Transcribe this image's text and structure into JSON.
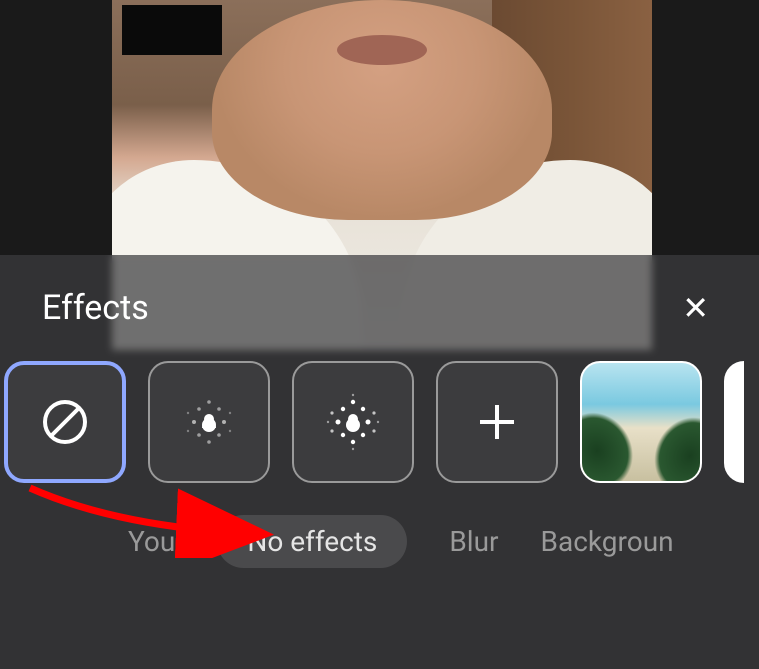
{
  "panel": {
    "title": "Effects",
    "close_label": "✕"
  },
  "tiles": {
    "none": {
      "name": "no-effect"
    },
    "blur_light": {
      "name": "blur-light"
    },
    "blur_strong": {
      "name": "blur-strong"
    },
    "add": {
      "name": "add-custom"
    },
    "bg1": {
      "name": "beach-background"
    }
  },
  "chips": {
    "you": "You",
    "no_effects": "No effects",
    "blur": "Blur",
    "backgrounds": "Backgroun"
  }
}
